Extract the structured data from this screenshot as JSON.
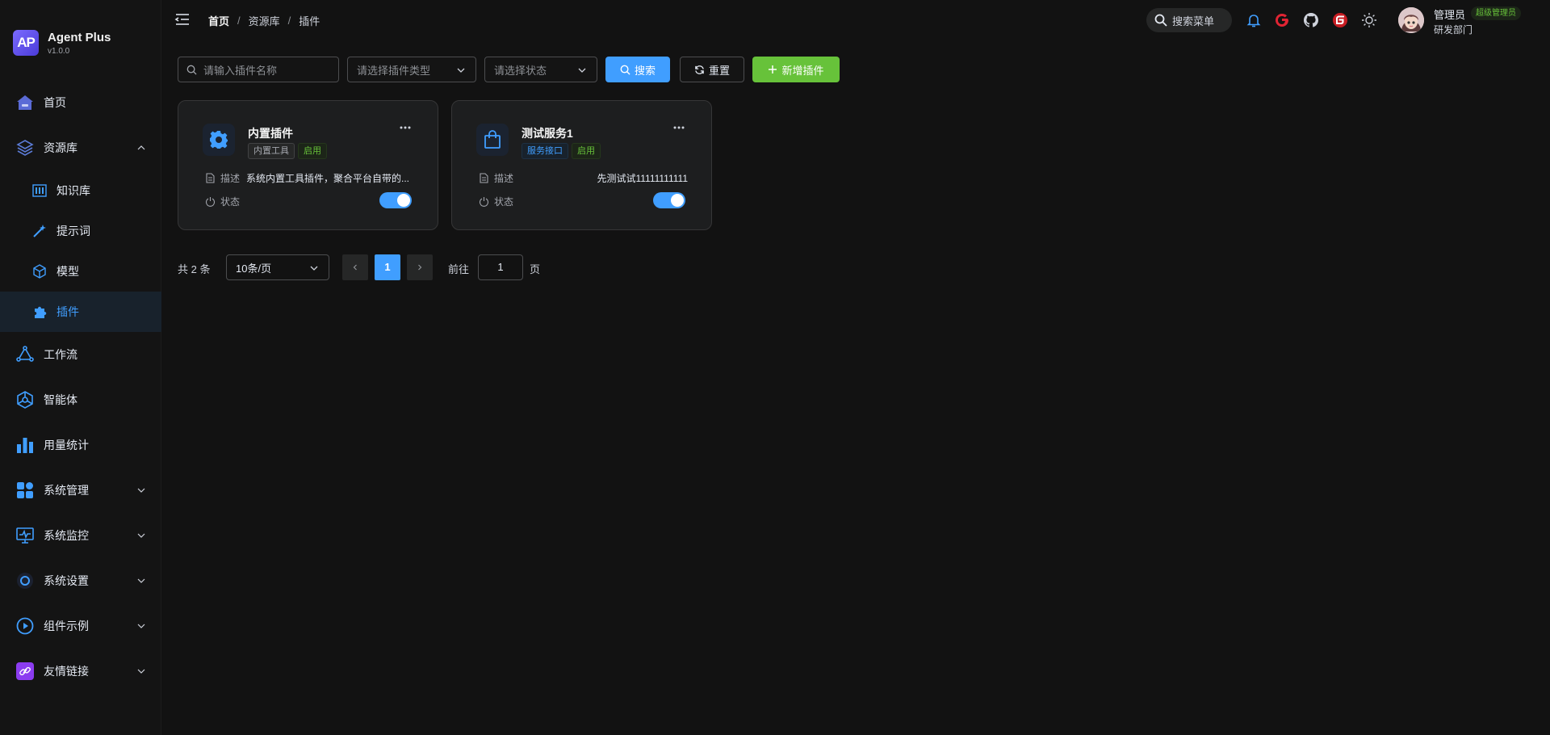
{
  "app": {
    "name": "Agent Plus",
    "version": "v1.0.0",
    "logo_text": "AP"
  },
  "sidebar": {
    "items": [
      {
        "label": "首页"
      },
      {
        "label": "资源库"
      },
      {
        "label": "知识库"
      },
      {
        "label": "提示词"
      },
      {
        "label": "模型"
      },
      {
        "label": "插件"
      },
      {
        "label": "工作流"
      },
      {
        "label": "智能体"
      },
      {
        "label": "用量统计"
      },
      {
        "label": "系统管理"
      },
      {
        "label": "系统监控"
      },
      {
        "label": "系统设置"
      },
      {
        "label": "组件示例"
      },
      {
        "label": "友情链接"
      }
    ]
  },
  "header": {
    "breadcrumb": [
      "首页",
      "资源库",
      "插件"
    ],
    "breadcrumb_sep": "/",
    "search_menu_label": "搜索菜单",
    "user": {
      "name": "管理员",
      "role": "超级管理员",
      "dept": "研发部门"
    }
  },
  "toolbar": {
    "name_placeholder": "请输入插件名称",
    "type_placeholder": "请选择插件类型",
    "status_placeholder": "请选择状态",
    "search_label": "搜索",
    "reset_label": "重置",
    "add_label": "新增插件"
  },
  "cards": [
    {
      "title": "内置插件",
      "tags": [
        "内置工具",
        "启用"
      ],
      "desc_label": "描述",
      "desc": "系统内置工具插件，聚合平台自带的...",
      "status_label": "状态",
      "enabled": true
    },
    {
      "title": "测试服务1",
      "tags": [
        "服务接口",
        "启用"
      ],
      "desc_label": "描述",
      "desc": "先测试试11111111111",
      "status_label": "状态",
      "enabled": true
    }
  ],
  "pagination": {
    "total_text": "共 2 条",
    "page_size": "10条/页",
    "current_page": "1",
    "goto_label": "前往",
    "goto_value": "1",
    "page_suffix": "页"
  },
  "colors": {
    "primary": "#409eff",
    "success": "#67c23a",
    "background": "#121212",
    "card": "#1d1e1f"
  }
}
